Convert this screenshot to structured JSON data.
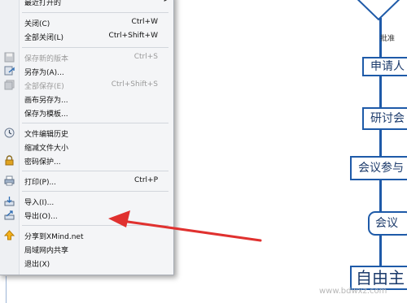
{
  "menu": {
    "items": [
      {
        "label": "最近打开的",
        "shortcut": "",
        "icon": "",
        "disabled": false
      },
      {
        "label": "关闭(C)",
        "shortcut": "Ctrl+W",
        "icon": "",
        "disabled": false
      },
      {
        "label": "全部关闭(L)",
        "shortcut": "Ctrl+Shift+W",
        "icon": "",
        "disabled": false
      },
      {
        "label": "保存新的版本",
        "shortcut": "Ctrl+S",
        "icon": "save-icon",
        "disabled": true
      },
      {
        "label": "另存为(A)...",
        "shortcut": "",
        "icon": "save-as-icon",
        "disabled": false
      },
      {
        "label": "全部保存(E)",
        "shortcut": "Ctrl+Shift+S",
        "icon": "save-all-icon",
        "disabled": true
      },
      {
        "label": "画布另存为...",
        "shortcut": "",
        "icon": "",
        "disabled": false
      },
      {
        "label": "保存为模板...",
        "shortcut": "",
        "icon": "",
        "disabled": false
      },
      {
        "label": "文件编辑历史",
        "shortcut": "",
        "icon": "clock-icon",
        "disabled": false
      },
      {
        "label": "缩减文件大小",
        "shortcut": "",
        "icon": "",
        "disabled": false
      },
      {
        "label": "密码保护...",
        "shortcut": "",
        "icon": "lock-icon",
        "disabled": false
      },
      {
        "label": "打印(P)...",
        "shortcut": "Ctrl+P",
        "icon": "print-icon",
        "disabled": false
      },
      {
        "label": "导入(I)...",
        "shortcut": "",
        "icon": "import-icon",
        "disabled": false
      },
      {
        "label": "导出(O)...",
        "shortcut": "",
        "icon": "export-icon",
        "disabled": false
      },
      {
        "label": "分享到XMind.net",
        "shortcut": "",
        "icon": "share-arrow-icon",
        "disabled": false
      },
      {
        "label": "局域网内共享",
        "shortcut": "",
        "icon": "",
        "disabled": false
      },
      {
        "label": "退出(X)",
        "shortcut": "",
        "icon": "",
        "disabled": false
      }
    ]
  },
  "canvas": {
    "edge_label": "批准",
    "nodes": [
      "申请人",
      "研讨会",
      "会议参与",
      "会议",
      "自由主"
    ]
  },
  "watermark": "www.bdwxz.com",
  "colors": {
    "accent": "#1e5aa8",
    "annotation_arrow": "#e0312f",
    "menu_background": "#f4f5f7",
    "disabled_text": "#9a9a9a"
  }
}
